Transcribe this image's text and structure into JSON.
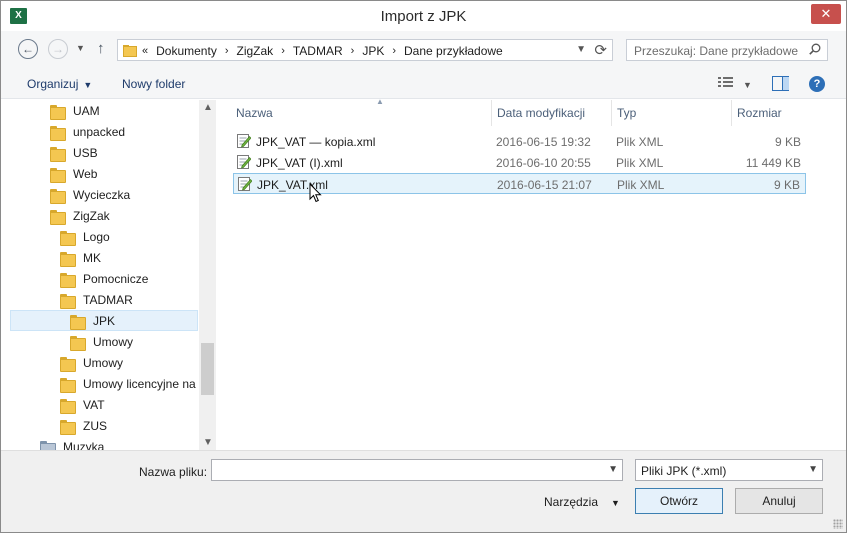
{
  "window": {
    "title": "Import z JPK",
    "app_icon": "excel-icon",
    "app_icon_letter": "X"
  },
  "nav": {
    "back_icon": "arrow-left-icon",
    "forward_icon": "arrow-right-icon",
    "up_icon": "arrow-up-icon",
    "breadcrumb_overflow": "«",
    "breadcrumb": [
      "Dokumenty",
      "ZigZak",
      "TADMAR",
      "JPK",
      "Dane przykładowe"
    ],
    "search_placeholder": "Przeszukaj: Dane przykładowe"
  },
  "toolbar": {
    "organize": "Organizuj",
    "new_folder": "Nowy folder"
  },
  "sidebar": {
    "items": [
      {
        "label": "UAM",
        "indent": 1
      },
      {
        "label": "unpacked",
        "indent": 1
      },
      {
        "label": "USB",
        "indent": 1
      },
      {
        "label": "Web",
        "indent": 1
      },
      {
        "label": "Wycieczka",
        "indent": 1
      },
      {
        "label": "ZigZak",
        "indent": 1
      },
      {
        "label": "Logo",
        "indent": 2
      },
      {
        "label": "MK",
        "indent": 2
      },
      {
        "label": "Pomocnicze",
        "indent": 2
      },
      {
        "label": "TADMAR",
        "indent": 2
      },
      {
        "label": "JPK",
        "indent": 3,
        "selected": true
      },
      {
        "label": "Umowy",
        "indent": 3
      },
      {
        "label": "Umowy",
        "indent": 2
      },
      {
        "label": "Umowy licencyjne na d",
        "indent": 2
      },
      {
        "label": "VAT",
        "indent": 2
      },
      {
        "label": "ZUS",
        "indent": 2
      },
      {
        "label": "Muzyka",
        "indent": 0,
        "music": true
      }
    ]
  },
  "filelist": {
    "columns": [
      "Nazwa",
      "Data modyfikacji",
      "Typ",
      "Rozmiar"
    ],
    "rows": [
      {
        "name": "JPK_VAT — kopia.xml",
        "date": "2016-06-15 19:32",
        "type": "Plik XML",
        "size": "9 KB"
      },
      {
        "name": "JPK_VAT (I).xml",
        "date": "2016-06-10 20:55",
        "type": "Plik XML",
        "size": "11 449 KB"
      },
      {
        "name": "JPK_VAT.xml",
        "date": "2016-06-15 21:07",
        "type": "Plik XML",
        "size": "9 KB",
        "selected": true
      }
    ]
  },
  "bottom": {
    "filename_label": "Nazwa pliku:",
    "filename_value": "",
    "filter": "Pliki JPK (*.xml)",
    "tools": "Narzędzia",
    "open": "Otwórz",
    "cancel": "Anuluj"
  },
  "colors": {
    "accent": "#2d6fb7",
    "selection": "#e5f3fb",
    "close_button": "#c7504d"
  }
}
